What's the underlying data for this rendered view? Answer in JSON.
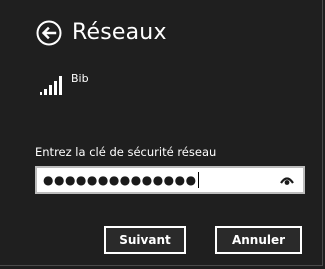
{
  "header": {
    "back_icon": "back-arrow-circle-icon",
    "title": "Réseaux"
  },
  "network": {
    "signal_icon": "wifi-signal-bars-icon",
    "name": "Bib"
  },
  "security": {
    "label": "Entrez la clé de sécurité réseau",
    "password_masked": "●●●●●●●●●●●●●●",
    "reveal_icon": "eye-reveal-password-icon"
  },
  "buttons": {
    "next_label": "Suivant",
    "cancel_label": "Annuler"
  },
  "colors": {
    "background": "#1f1f1f",
    "text": "#ffffff",
    "input_background": "#ffffff",
    "input_border": "#bcbcbc"
  }
}
